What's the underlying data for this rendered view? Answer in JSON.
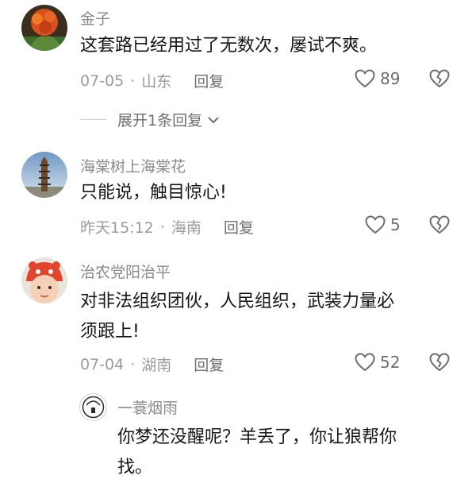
{
  "comments": [
    {
      "username": "金子",
      "text": "这套路已经用过了无数次，屡试不爽。",
      "date": "07-05",
      "location": "山东",
      "reply_label": "回复",
      "likes": "89",
      "expand_label": "展开1条回复"
    },
    {
      "username": "海棠树上海棠花",
      "text": "只能说，触目惊心!",
      "date": "昨天15:12",
      "location": "海南",
      "reply_label": "回复",
      "likes": "5"
    },
    {
      "username": "治农党阳治平",
      "text_line1": "对非法组织团伙，人民组织，武装力量必",
      "text_line2": "须跟上!",
      "date": "07-04",
      "location": "湖南",
      "reply_label": "回复",
      "likes": "52"
    }
  ],
  "reply": {
    "username": "一蓑烟雨",
    "text_line1": "你梦还没醒呢？羊丢了，你让狼帮你",
    "text_line2": "找。"
  },
  "separator": "·",
  "icons": {
    "like": "heart-outline-icon",
    "dislike": "broken-heart-icon",
    "expand": "chevron-down-icon"
  }
}
